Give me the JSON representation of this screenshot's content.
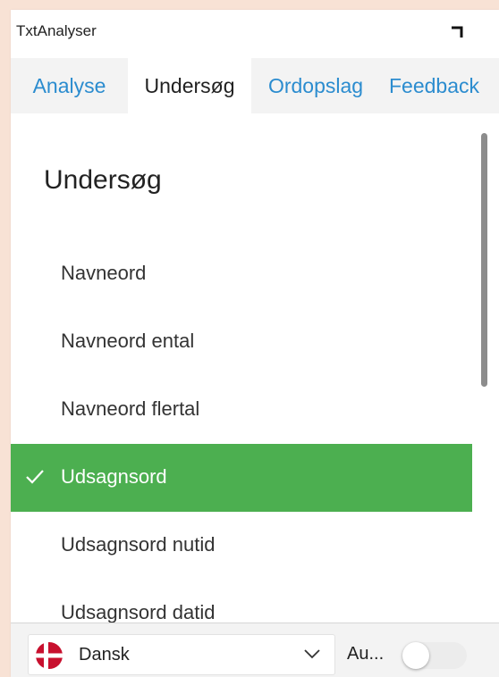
{
  "window": {
    "title": "TxtAnalyser",
    "collapse_icon": "corner-collapse-icon"
  },
  "tabs": [
    {
      "label": "Analyse",
      "active": false
    },
    {
      "label": "Undersøg",
      "active": true
    },
    {
      "label": "Ordopslag",
      "active": false
    },
    {
      "label": "Feedback",
      "active": false
    }
  ],
  "main": {
    "title": "Undersøg",
    "items": [
      {
        "label": "Navneord",
        "selected": false
      },
      {
        "label": "Navneord ental",
        "selected": false
      },
      {
        "label": "Navneord flertal",
        "selected": false
      },
      {
        "label": "Udsagnsord",
        "selected": true
      },
      {
        "label": "Udsagnsord nutid",
        "selected": false
      },
      {
        "label": "Udsagnsord datid",
        "selected": false
      }
    ]
  },
  "footer": {
    "language": {
      "label": "Dansk",
      "icon": "danish-flag-icon"
    },
    "auto_label": "Au...",
    "auto_toggle_on": false
  },
  "colors": {
    "accent_tab": "#2b8ccf",
    "selected_bg": "#4caf50",
    "page_bg": "#f8e2d5"
  }
}
